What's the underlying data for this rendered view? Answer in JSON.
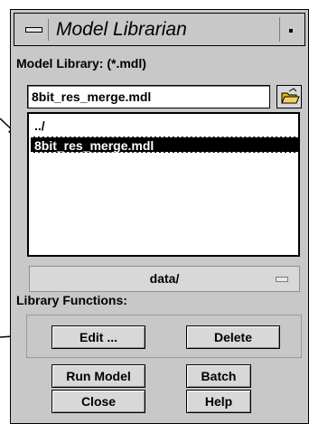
{
  "window": {
    "title": "Model Librarian"
  },
  "library": {
    "label": "Model Library: (*.mdl)",
    "filename_value": "8bit_res_merge.mdl",
    "items": [
      {
        "label": "../",
        "selected": false
      },
      {
        "label": "8bit_res_merge.mdl",
        "selected": true
      }
    ],
    "directory": "data/"
  },
  "functions": {
    "label": "Library Functions:",
    "edit_label": "Edit ...",
    "delete_label": "Delete"
  },
  "buttons": {
    "run_model": "Run Model",
    "batch": "Batch",
    "close": "Close",
    "help": "Help"
  },
  "colors": {
    "window_bg": "#c8c8c8",
    "selection_bg": "#000000",
    "folder_icon": "#e0b020"
  }
}
